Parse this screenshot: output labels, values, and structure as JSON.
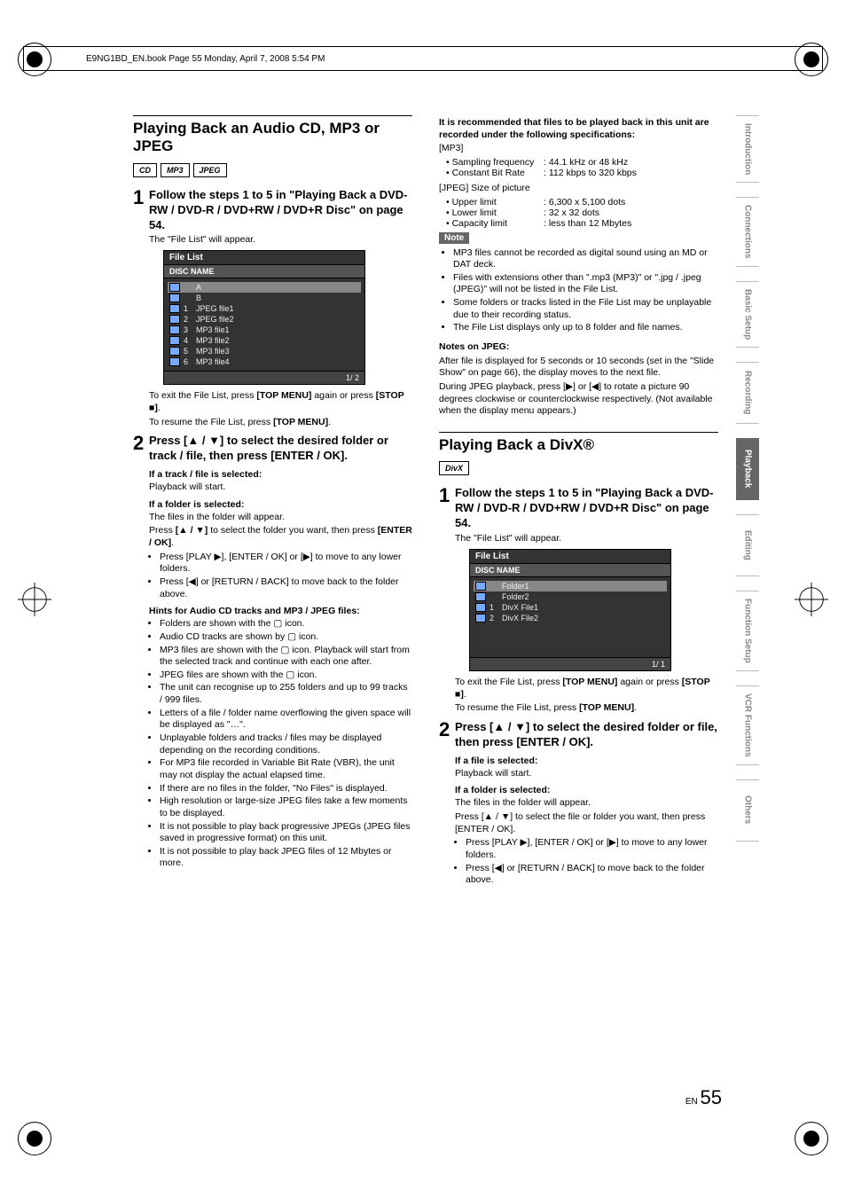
{
  "crop_header": "E9NG1BD_EN.book  Page 55  Monday, April 7, 2008  5:54 PM",
  "left": {
    "title": "Playing Back an Audio CD, MP3 or JPEG",
    "badges": [
      "CD",
      "MP3",
      "JPEG"
    ],
    "step1": "Follow the steps 1 to 5 in \"Playing Back a DVD-RW / DVD-R / DVD+RW / DVD+R Disc\" on page 54.",
    "step1_note": "The \"File List\" will appear.",
    "filelist": {
      "title": "File List",
      "subtitle": "DISC NAME",
      "rows": [
        {
          "label": "A",
          "num": ""
        },
        {
          "label": "B",
          "num": ""
        },
        {
          "label": "JPEG file1",
          "num": "1"
        },
        {
          "label": "JPEG file2",
          "num": "2"
        },
        {
          "label": "MP3 file1",
          "num": "3"
        },
        {
          "label": "MP3 file2",
          "num": "4"
        },
        {
          "label": "MP3 file3",
          "num": "5"
        },
        {
          "label": "MP3 file4",
          "num": "6"
        }
      ],
      "footer": "1/ 2"
    },
    "exit_text_a": "To exit the File List, press ",
    "exit_text_b": " again or press ",
    "exit_top_menu": "[TOP MENU]",
    "exit_stop": "[STOP ■]",
    "resume_a": "To resume the File List, press ",
    "resume_b": "[TOP MENU]",
    "step2": "Press [▲ / ▼] to select the desired folder or track / file, then press [ENTER / OK].",
    "track_head": "If a track / file is selected:",
    "track_body": "Playback will start.",
    "folder_head": "If a folder is selected:",
    "folder_body1": "The files in the folder will appear.",
    "folder_body2a": "Press ",
    "folder_body2b": "[▲ / ▼]",
    "folder_body2c": " to select the folder you want, then press ",
    "folder_body2d": "[ENTER / OK]",
    "nav_bullets": [
      "Press [PLAY ▶], [ENTER / OK] or [▶] to move to any lower folders.",
      "Press [◀] or [RETURN / BACK] to move back to the folder above."
    ],
    "hints_head": "Hints for Audio CD tracks and MP3 / JPEG files:",
    "hints": [
      "Folders are shown with the  ▢  icon.",
      "Audio CD tracks are shown by  ▢  icon.",
      "MP3 files are shown with the  ▢  icon. Playback will start from the selected track and continue with each one after.",
      "JPEG files are shown with the  ▢  icon.",
      "The unit can recognise up to 255 folders and up to 99 tracks / 999 files.",
      "Letters of a file / folder name overflowing the given space will be displayed as \"…\".",
      "Unplayable folders and tracks / files may be displayed depending on the recording conditions.",
      "For MP3 file recorded in Variable Bit Rate (VBR), the unit may not display the actual elapsed time.",
      "If there are no files in the folder, \"No Files\" is displayed.",
      "High resolution or large-size JPEG files take a few moments to be displayed.",
      "It is not possible to play back progressive JPEGs (JPEG files saved in progressive format) on this unit.",
      "It is not possible to play back JPEG files of 12 Mbytes or more."
    ]
  },
  "right": {
    "rec_header": "It is recommended that files to be played back in this unit are recorded under the following specifications:",
    "mp3_label": "[MP3]",
    "mp3_specs": [
      {
        "k": "Sampling frequency",
        "v": "44.1 kHz or 48 kHz"
      },
      {
        "k": "Constant Bit Rate",
        "v": "112 kbps to 320 kbps"
      }
    ],
    "jpeg_label": "[JPEG] Size of picture",
    "jpeg_specs": [
      {
        "k": "Upper limit",
        "v": "6,300 x 5,100 dots"
      },
      {
        "k": "Lower limit",
        "v": "32 x 32 dots"
      },
      {
        "k": "Capacity limit",
        "v": "less than 12 Mbytes"
      }
    ],
    "note_label": "Note",
    "note_bullets": [
      "MP3 files cannot be recorded as digital sound using an MD or DAT deck.",
      "Files with extensions other than \".mp3 (MP3)\" or \".jpg / .jpeg (JPEG)\" will not be listed in the File List.",
      "Some folders or tracks listed in the File List may be unplayable due to their recording status.",
      "The File List displays only up to 8 folder and file names."
    ],
    "jpeg_notes_head": "Notes on JPEG:",
    "jpeg_notes_1": "After file is displayed for 5 seconds or 10 seconds (set in the \"Slide Show\" on page 66), the display moves to the next file.",
    "jpeg_notes_2": "During JPEG playback, press [▶] or [◀] to rotate a picture 90 degrees clockwise or counterclockwise respectively. (Not available when the display menu appears.)",
    "divx_title": "Playing Back a DivX®",
    "divx_badge": "DivX",
    "divx_step1": "Follow the steps 1 to 5 in \"Playing Back a DVD-RW / DVD-R / DVD+RW / DVD+R Disc\" on page 54.",
    "divx_step1_note": "The \"File List\" will appear.",
    "filelist": {
      "title": "File List",
      "subtitle": "DISC NAME",
      "rows": [
        {
          "label": "Folder1",
          "num": ""
        },
        {
          "label": "Folder2",
          "num": ""
        },
        {
          "label": "DivX File1",
          "num": "1"
        },
        {
          "label": "DivX File2",
          "num": "2"
        }
      ],
      "footer": "1/ 1"
    },
    "divx_exit_a": "To exit the File List, press ",
    "divx_exit_b": "[TOP MENU]",
    "divx_exit_c": " again or press ",
    "divx_exit_d": "[STOP ■]",
    "divx_resume_a": "To resume the File List, press ",
    "divx_resume_b": "[TOP MENU]",
    "divx_step2": "Press [▲ / ▼] to select the desired folder or file, then press [ENTER / OK].",
    "divx_file_head": "If a file is selected:",
    "divx_file_body": "Playback will start.",
    "divx_folder_head": "If a folder is selected:",
    "divx_folder_body1": "The files in the folder will appear.",
    "divx_folder_body2": "Press [▲ / ▼] to select the file or folder you want, then press [ENTER / OK].",
    "divx_nav_bullets": [
      "Press [PLAY ▶], [ENTER / OK] or [▶] to move to any lower folders.",
      "Press [◀] or [RETURN / BACK] to move back to the folder above."
    ]
  },
  "tabs": [
    "Introduction",
    "Connections",
    "Basic Setup",
    "Recording",
    "Playback",
    "Editing",
    "Function Setup",
    "VCR Functions",
    "Others"
  ],
  "active_tab": "Playback",
  "page_en": "EN",
  "page_num": "55"
}
